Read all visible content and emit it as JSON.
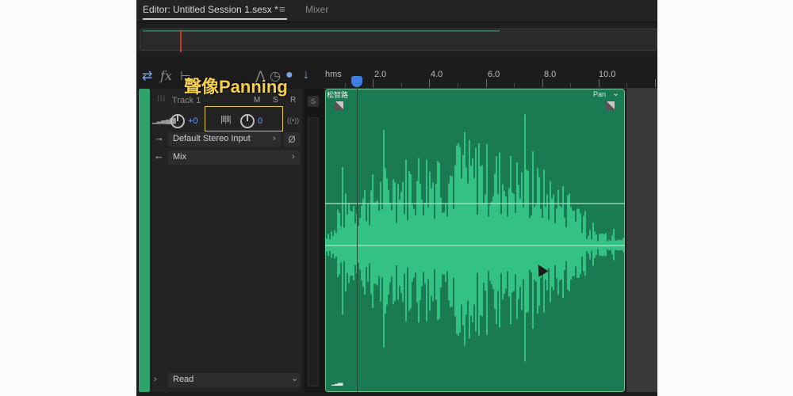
{
  "tabs": {
    "editor": "Editor: Untitled Session 1.sesx *",
    "menu_icon": "≡",
    "mixer": "Mixer"
  },
  "toolbar": {
    "icons": [
      "swap-icon",
      "fx-icon",
      "split-icon",
      "automation-icon",
      "timer-icon",
      "record-icon",
      "input-icon"
    ],
    "fx_label": "fx"
  },
  "annotation": "聲像Panning",
  "track": {
    "name": "Track 1",
    "mute": "M",
    "solo": "S",
    "record": "R",
    "volume_value": "+0",
    "pan_value": "0",
    "input": "Default Stereo Input",
    "output": "Mix",
    "automation_mode": "Read",
    "color": "#2fa36b"
  },
  "ruler": {
    "unit": "hms",
    "ticks": [
      "2.0",
      "4.0",
      "6.0",
      "8.0",
      "10.0"
    ]
  },
  "clip": {
    "name": "松智路",
    "pan_label": "Pan",
    "color": "#1a7a52",
    "wave_color": "#3fe29a"
  },
  "colors": {
    "accent": "#3d7fe0",
    "highlight_box": "#e6c64a"
  }
}
